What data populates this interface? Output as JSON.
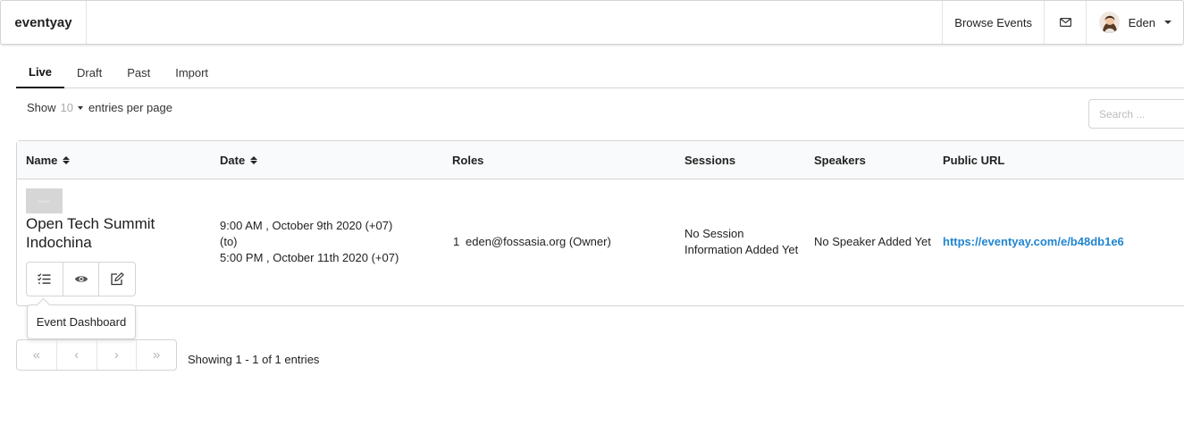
{
  "navbar": {
    "brand": "eventyay",
    "browse_events": "Browse Events",
    "user_name": "Eden"
  },
  "tabs": [
    {
      "label": "Live",
      "active": true
    },
    {
      "label": "Draft",
      "active": false
    },
    {
      "label": "Past",
      "active": false
    },
    {
      "label": "Import",
      "active": false
    }
  ],
  "entries": {
    "show_label": "Show",
    "per_page": "10",
    "per_page_suffix": "entries per page"
  },
  "search": {
    "placeholder": "Search ..."
  },
  "table": {
    "headers": {
      "name": "Name",
      "date": "Date",
      "roles": "Roles",
      "sessions": "Sessions",
      "speakers": "Speakers",
      "public_url": "Public URL"
    },
    "rows": [
      {
        "thumbnail_text": "EVENT",
        "name_line1": "Open Tech Summit",
        "name_line2": "Indochina",
        "date_start": "9:00 AM , October 9th 2020 (+07)",
        "date_sep": "(to)",
        "date_end": "5:00 PM , October 11th 2020 (+07)",
        "roles_count": "1",
        "roles_email": "eden@fossasia.org (Owner)",
        "sessions_line1": "No Session",
        "sessions_line2": "Information Added Yet",
        "speakers": "No Speaker Added Yet",
        "public_url": "https://eventyay.com/e/b48db1e6"
      }
    ]
  },
  "tooltip": {
    "text": "Event Dashboard"
  },
  "pagination": {
    "first": "«",
    "prev": "‹",
    "next": "›",
    "last": "»",
    "showing": "Showing 1 - 1 of 1 entries"
  },
  "colors": {
    "link": "#2185d0",
    "border": "#d4d4d5",
    "header_bg": "#f9fafb"
  }
}
